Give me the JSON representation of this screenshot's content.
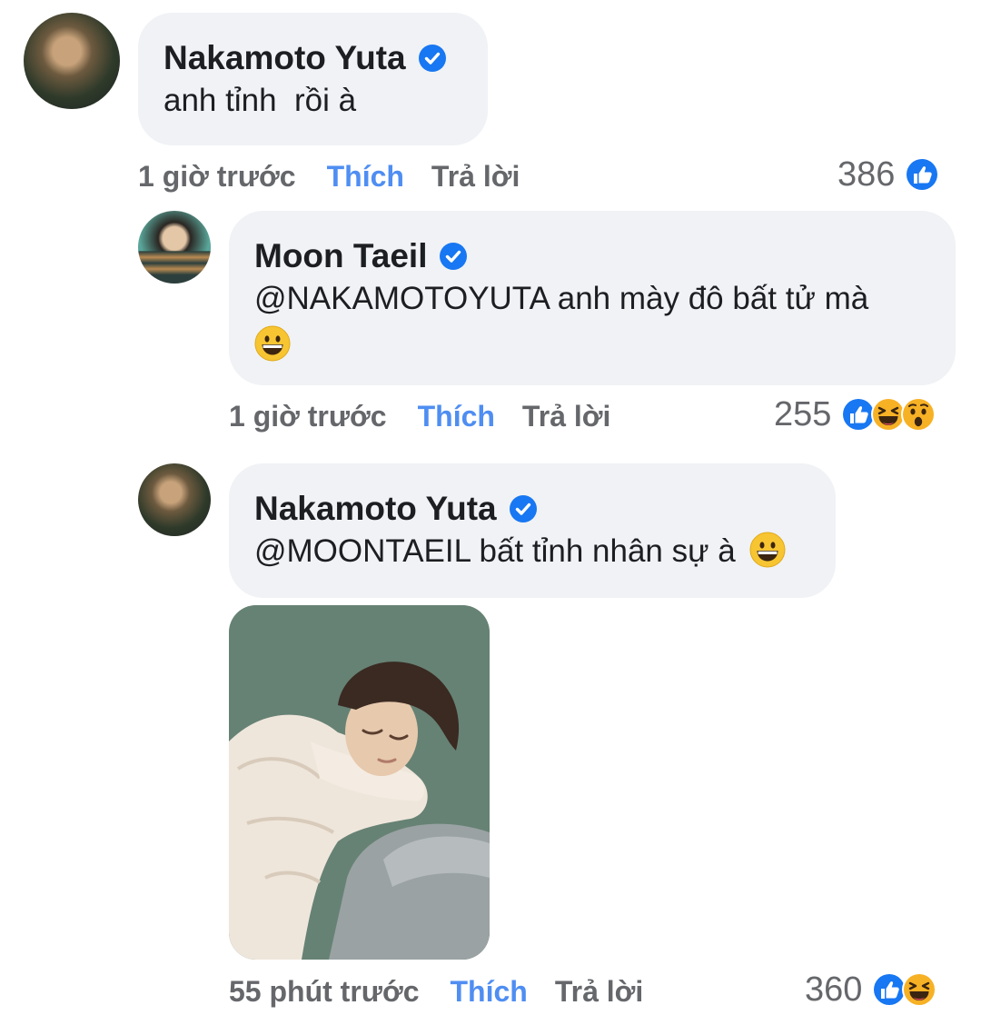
{
  "comments": [
    {
      "author": "Nakamoto Yuta",
      "text": "anh tỉnh  rồi à",
      "time": "1 giờ trước",
      "like_label": "Thích",
      "reply_label": "Trả lời",
      "reaction_count": "386",
      "reactions": [
        "like-reaction-icon"
      ]
    },
    {
      "author": "Moon Taeil",
      "text": "@NAKAMOTOYUTA anh mày đô bất tử mà",
      "emoji": "grinning-face-emoji",
      "time": "1 giờ trước",
      "like_label": "Thích",
      "reply_label": "Trả lời",
      "reaction_count": "255",
      "reactions": [
        "like-reaction-icon",
        "haha-reaction-icon",
        "wow-reaction-icon"
      ]
    },
    {
      "author": "Nakamoto Yuta",
      "text": "@MOONTAEIL bất tỉnh nhân sự à",
      "emoji": "grinning-face-emoji",
      "attachment": "photo",
      "time": "55 phút trước",
      "like_label": "Thích",
      "reply_label": "Trả lời",
      "reaction_count": "360",
      "reactions": [
        "like-reaction-icon",
        "haha-reaction-icon"
      ]
    }
  ],
  "colors": {
    "bubble": "#f0f2f5",
    "like_link": "#4f8ef2",
    "meta_text": "#65676b",
    "verified": "#1877f2"
  }
}
